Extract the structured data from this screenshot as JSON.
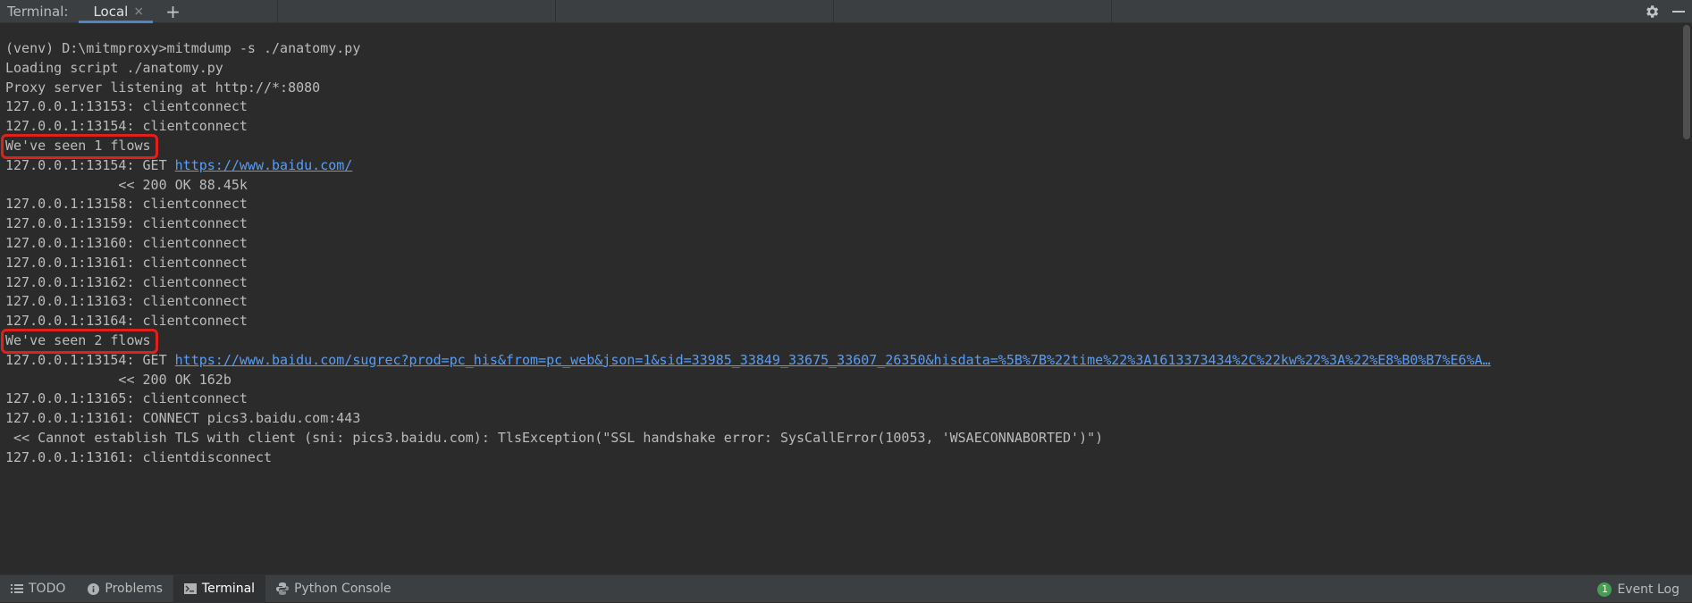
{
  "header": {
    "title": "Terminal:",
    "tab_label": "Local",
    "tab_close": "×",
    "add_tab": "+"
  },
  "terminal": {
    "lines": [
      {
        "text": "(venv) D:\\mitmproxy>mitmdump -s ./anatomy.py"
      },
      {
        "text": "Loading script ./anatomy.py"
      },
      {
        "text": "Proxy server listening at http://*:8080"
      },
      {
        "text": "127.0.0.1:13153: clientconnect"
      },
      {
        "text": "127.0.0.1:13154: clientconnect"
      },
      {
        "text": "We've seen 1 flows",
        "highlight": true
      },
      {
        "prefix": "127.0.0.1:13154: GET ",
        "link": "https://www.baidu.com/"
      },
      {
        "text": "              << 200 OK 88.45k"
      },
      {
        "text": "127.0.0.1:13158: clientconnect"
      },
      {
        "text": "127.0.0.1:13159: clientconnect"
      },
      {
        "text": "127.0.0.1:13160: clientconnect"
      },
      {
        "text": "127.0.0.1:13161: clientconnect"
      },
      {
        "text": "127.0.0.1:13162: clientconnect"
      },
      {
        "text": "127.0.0.1:13163: clientconnect"
      },
      {
        "text": "127.0.0.1:13164: clientconnect"
      },
      {
        "text": "We've seen 2 flows",
        "highlight": true
      },
      {
        "prefix": "127.0.0.1:13154: GET ",
        "link": "https://www.baidu.com/sugrec?prod=pc_his&from=pc_web&json=1&sid=33985_33849_33675_33607_26350&hisdata=%5B%7B%22time%22%3A1613373434%2C%22kw%22%3A%22%E8%B0%B7%E6%A…"
      },
      {
        "text": "              << 200 OK 162b"
      },
      {
        "text": "127.0.0.1:13165: clientconnect"
      },
      {
        "text": "127.0.0.1:13161: CONNECT pics3.baidu.com:443"
      },
      {
        "text": " << Cannot establish TLS with client (sni: pics3.baidu.com): TlsException(\"SSL handshake error: SysCallError(10053, 'WSAECONNABORTED')\")"
      },
      {
        "text": "127.0.0.1:13161: clientdisconnect"
      }
    ]
  },
  "statusbar": {
    "tools": [
      {
        "label": "TODO",
        "icon": "list-icon"
      },
      {
        "label": "Problems",
        "icon": "info-icon"
      },
      {
        "label": "Terminal",
        "icon": "terminal-icon",
        "active": true
      },
      {
        "label": "Python Console",
        "icon": "python-icon"
      }
    ],
    "event_log_label": "Event Log",
    "event_log_count": "1"
  },
  "colors": {
    "background": "#2b2b2b",
    "text": "#bbbbbb",
    "link": "#589df6",
    "highlight_border": "#e0211b",
    "tab_underline": "#4a88c7",
    "badge": "#499c54"
  }
}
